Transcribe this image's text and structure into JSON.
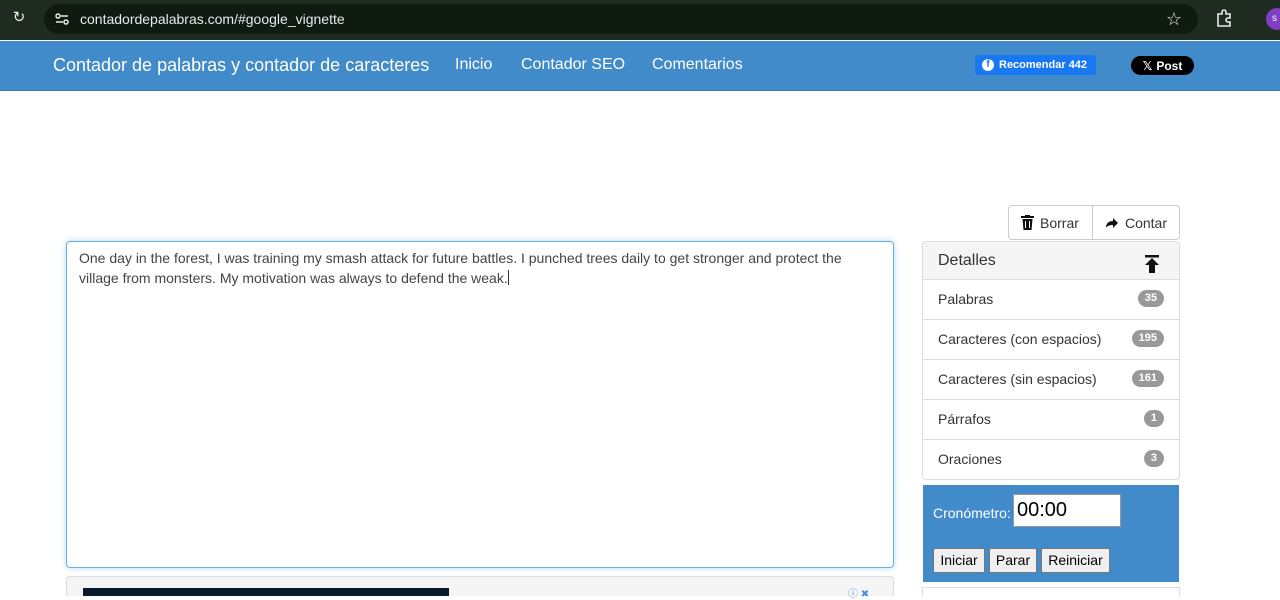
{
  "browser": {
    "url": "contadordepalabras.com/#google_vignette",
    "profile_initial": "s"
  },
  "navbar": {
    "brand": "Contador de palabras y contador de caracteres",
    "links": [
      "Inicio",
      "Contador SEO",
      "Comentarios"
    ],
    "fb_label": "Recomendar 442",
    "x_label": "Post"
  },
  "toolbar": {
    "clear_label": "Borrar",
    "count_label": "Contar"
  },
  "editor": {
    "text": "One day in the forest, I was training my smash attack for future battles. I punched trees daily to get stronger and protect the village from monsters. My motivation was always to defend the weak."
  },
  "details": {
    "title": "Detalles",
    "rows": [
      {
        "label": "Palabras",
        "value": "35"
      },
      {
        "label": "Caracteres (con espacios)",
        "value": "195"
      },
      {
        "label": "Caracteres (sin espacios)",
        "value": "161"
      },
      {
        "label": "Párrafos",
        "value": "1"
      },
      {
        "label": "Oraciones",
        "value": "3"
      }
    ]
  },
  "stopwatch": {
    "label": "Cronómetro:",
    "value": "00:00",
    "start_label": "Iniciar",
    "stop_label": "Parar",
    "reset_label": "Reiniciar"
  },
  "colors": {
    "navbar": "#428bca",
    "badge": "#999999"
  }
}
